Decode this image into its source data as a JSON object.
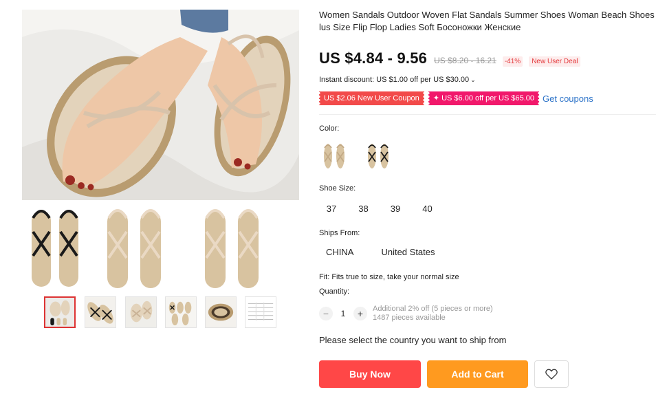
{
  "product": {
    "title_line1": "Women Sandals Outdoor Woven Flat Sandals Summer Shoes Woman Beach Shoes P",
    "title_line2": "lus Size Flip Flop Ladies Soft Босоножки Женские"
  },
  "price": {
    "current": "US $4.84 - 9.56",
    "original": "US $8.20 - 16.21",
    "discount": "-41%",
    "deal_badge": "New User Deal"
  },
  "instant_discount": {
    "text": "Instant discount: US $1.00 off per US $30.00",
    "chevron": "⌄"
  },
  "coupons": {
    "new_user": "US $2.06 New User Coupon",
    "store": "✦ US $6.00 off per US $65.00",
    "get_link": "Get coupons"
  },
  "color": {
    "label": "Color:",
    "options": [
      {
        "name": "beige",
        "strap_color": "#d9c3aa"
      },
      {
        "name": "black",
        "strap_color": "#1a1a1a"
      }
    ]
  },
  "shoe_size": {
    "label": "Shoe Size:",
    "options": [
      "37",
      "38",
      "39",
      "40"
    ]
  },
  "ships_from": {
    "label": "Ships From:",
    "options": [
      "CHINA",
      "United States"
    ]
  },
  "fit": "Fit: Fits true to size, take your normal size",
  "quantity": {
    "label": "Quantity:",
    "minus": "−",
    "plus": "+",
    "value": "1",
    "bulk_note": "Additional 2% off (5 pieces or more)",
    "available": "1487 pieces available"
  },
  "ship_prompt": "Please select the country you want to ship from",
  "buttons": {
    "buy_now": "Buy Now",
    "add_to_cart": "Add to Cart"
  },
  "icons": {
    "wishlist": "heart-icon"
  },
  "colors": {
    "buy_now": "#ff4747",
    "add_to_cart": "#ff9a1f",
    "coupon_red": "#f24a4a",
    "coupon_pink": "#f1186b",
    "link": "#2e74c9",
    "thumb_active_border": "#dd3333"
  },
  "gallery": {
    "thumbnails": [
      "main-view",
      "black-worn",
      "beige-worn",
      "pair-overview",
      "sole-detail",
      "size-chart"
    ]
  }
}
